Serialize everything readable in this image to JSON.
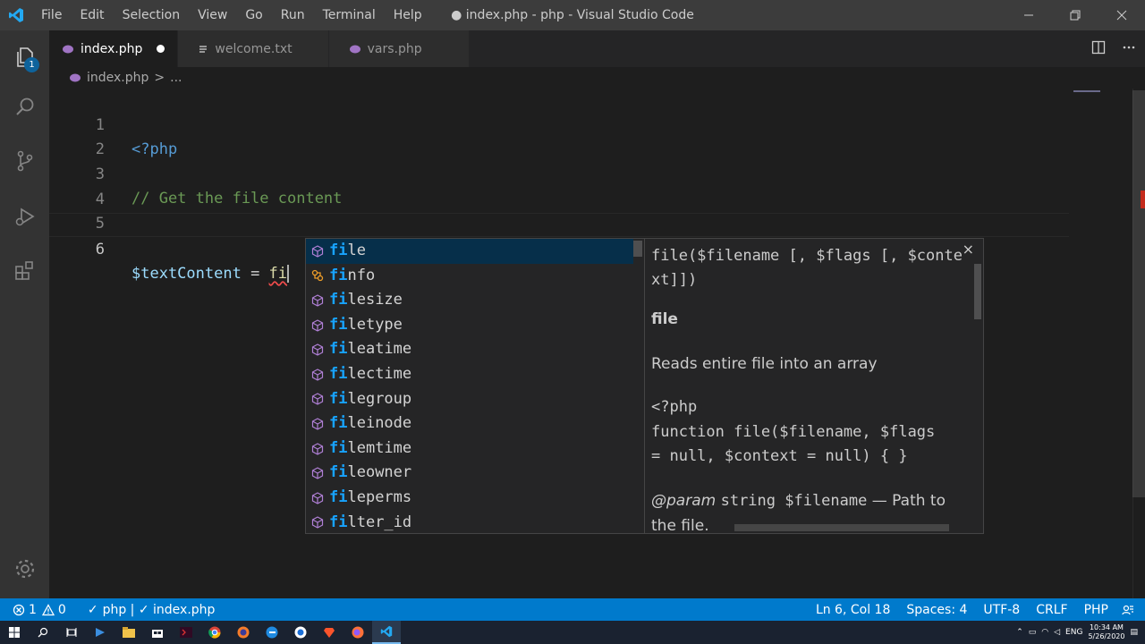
{
  "window": {
    "title": "● index.php - php - Visual Studio Code",
    "menu": [
      "File",
      "Edit",
      "Selection",
      "View",
      "Go",
      "Run",
      "Terminal",
      "Help"
    ]
  },
  "activity_bar": {
    "explorer_badge": "1"
  },
  "tabs": [
    {
      "label": "index.php",
      "active": true,
      "modified": true
    },
    {
      "label": "welcome.txt",
      "active": false,
      "modified": false
    },
    {
      "label": "vars.php",
      "active": false,
      "modified": false
    }
  ],
  "breadcrumb": {
    "file": "index.php",
    "separator": ">",
    "rest": "..."
  },
  "editor": {
    "lines": [
      {
        "num": "1",
        "text": "<?php"
      },
      {
        "num": "2",
        "text": ""
      },
      {
        "num": "3",
        "text": "// Get the file content"
      },
      {
        "num": "4",
        "text": ""
      },
      {
        "num": "5",
        "text": ""
      },
      {
        "num": "6",
        "var": "$textContent",
        "op": " = ",
        "typed": "fi"
      }
    ]
  },
  "suggestions": [
    {
      "match": "fi",
      "rest": "le",
      "kind": "method"
    },
    {
      "match": "fi",
      "rest": "nfo",
      "kind": "class"
    },
    {
      "match": "fi",
      "rest": "lesize",
      "kind": "method"
    },
    {
      "match": "fi",
      "rest": "letype",
      "kind": "method"
    },
    {
      "match": "fi",
      "rest": "leatime",
      "kind": "method"
    },
    {
      "match": "fi",
      "rest": "lectime",
      "kind": "method"
    },
    {
      "match": "fi",
      "rest": "legroup",
      "kind": "method"
    },
    {
      "match": "fi",
      "rest": "leinode",
      "kind": "method"
    },
    {
      "match": "fi",
      "rest": "lemtime",
      "kind": "method"
    },
    {
      "match": "fi",
      "rest": "leowner",
      "kind": "method"
    },
    {
      "match": "fi",
      "rest": "leperms",
      "kind": "method"
    },
    {
      "match": "fi",
      "rest": "lter_id",
      "kind": "method"
    }
  ],
  "details": {
    "signature": "file($filename [, $flags [, $context]])",
    "name": "file",
    "description": "Reads entire file into an array",
    "code_line1": "<?php",
    "code_line2": "function file($filename, $flags",
    "code_line3": "= null, $context = null) { }",
    "param_tag": "@param",
    "param_type": "string $filename",
    "param_desc": " — Path to the file.",
    "close": "×"
  },
  "status_bar": {
    "errors": "1",
    "warnings": "0",
    "php": "php | ✓ index.php",
    "position": "Ln 6, Col 18",
    "spaces": "Spaces: 4",
    "encoding": "UTF-8",
    "eol": "CRLF",
    "language": "PHP"
  },
  "taskbar": {
    "lang": "ENG",
    "time": "10:34 AM",
    "date": "5/26/2020"
  },
  "colors": {
    "accent": "#007acc",
    "editor_bg": "#1e1e1e",
    "match": "#18a3ff"
  }
}
